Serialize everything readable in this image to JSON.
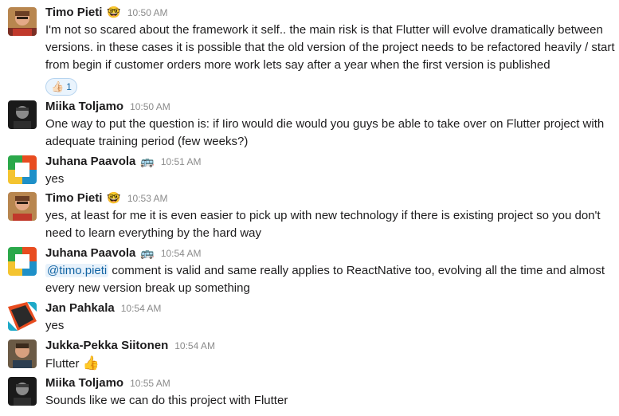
{
  "messages": [
    {
      "author": "Timo Pieti",
      "status_emoji": "🤓",
      "time": "10:50 AM",
      "text_lines": [
        "I'm not so scared about the framework it self.. the main risk is that Flutter will evolve dramatically between",
        "versions. in these cases it is possible that the old version of the project needs to be refactored heavily / start",
        "from begin if customer orders more work lets say after a year when the first version is published"
      ],
      "reaction": {
        "emoji": "👍🏻",
        "count": "1"
      },
      "avatar": "photo-timo"
    },
    {
      "author": "Miika Toljamo",
      "time": "10:50 AM",
      "text_lines": [
        "One way to put the question is: if Iiro would die would you guys be able to take over on Flutter project with",
        "adequate training period (few weeks?)"
      ],
      "avatar": "photo-miika"
    },
    {
      "author": "Juhana Paavola",
      "status_emoji": "🚌",
      "time": "10:51 AM",
      "text_lines": [
        "yes"
      ],
      "avatar": "logo-tiles"
    },
    {
      "author": "Timo Pieti",
      "status_emoji": "🤓",
      "time": "10:53 AM",
      "text_lines": [
        "yes, at least for me it is even easier to pick up with new technology if there is existing project so you don't",
        "need to learn everything by the hard way"
      ],
      "avatar": "photo-timo"
    },
    {
      "author": "Juhana Paavola",
      "status_emoji": "🚌",
      "time": "10:54 AM",
      "mention": "@timo.pieti",
      "text_lines": [
        " comment is valid and same really applies to ReactNative too, evolving all the time and almost",
        "every new version break up something"
      ],
      "avatar": "logo-tiles"
    },
    {
      "author": "Jan Pahkala",
      "time": "10:54 AM",
      "text_lines": [
        "yes"
      ],
      "avatar": "logo-diamond"
    },
    {
      "author": "Jukka-Pekka Siitonen",
      "time": "10:54 AM",
      "text_lines": [
        "Flutter"
      ],
      "inline_emoji": "👍",
      "avatar": "photo-jukka"
    },
    {
      "author": "Miika Toljamo",
      "time": "10:55 AM",
      "text_lines": [
        "Sounds like we can do this project with Flutter"
      ],
      "avatar": "photo-miika"
    }
  ],
  "colors": {
    "mention_text": "#1264a3",
    "mention_bg": "#e8f2fb",
    "timestamp": "#8b8b8b",
    "reaction_border": "#b6d4ef",
    "reaction_bg": "#eaf4fd"
  }
}
